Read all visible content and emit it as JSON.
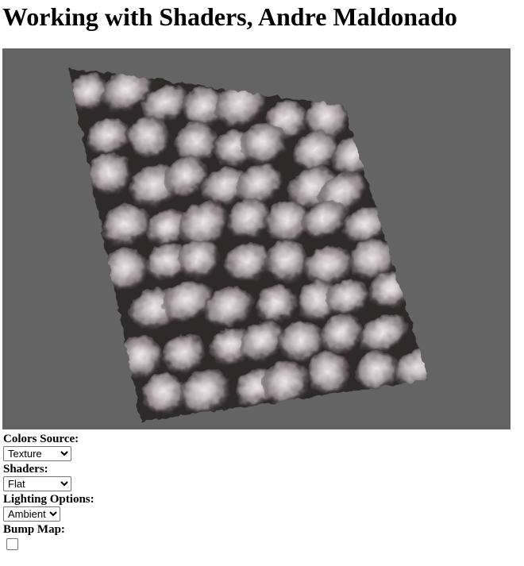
{
  "page": {
    "title": "Working with Shaders, Andre Maldonado"
  },
  "viewport": {
    "background_color": "#646464",
    "surface_colors": {
      "dark": "#2a2628",
      "mid": "#6e6466",
      "light": "#c8c0c2",
      "highlight": "#ece8ea"
    }
  },
  "controls": {
    "colors_source": {
      "label": "Colors Source:",
      "selected": "Texture"
    },
    "shaders": {
      "label": "Shaders:",
      "selected": "Flat"
    },
    "lighting": {
      "label": "Lighting Options:",
      "selected": "Ambient"
    },
    "bump_map": {
      "label": "Bump Map:",
      "checked": false
    }
  }
}
